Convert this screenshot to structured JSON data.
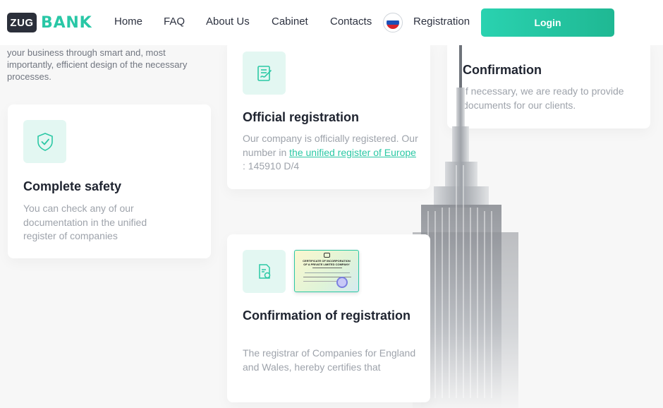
{
  "header": {
    "logo_zug": "ZUG",
    "logo_bank": "BANK",
    "nav": [
      {
        "label": "Home"
      },
      {
        "label": "FAQ"
      },
      {
        "label": "About Us"
      },
      {
        "label": "Cabinet"
      },
      {
        "label": "Contacts"
      }
    ],
    "registration_label": "Registration",
    "login_label": "Login"
  },
  "intro": {
    "text": "your business through smart and, most importantly, efficient design of the necessary processes."
  },
  "cards": {
    "safety": {
      "title": "Complete safety",
      "text": "You can check any of our documentation in the unified register of companies"
    },
    "official": {
      "title": "Official registration",
      "text_before": "Our company is officially registered. Our number in ",
      "link": "the unified register of Europe",
      "text_after": " : 145910 D/4"
    },
    "confirmation": {
      "title": "Confirmation",
      "text": "If necessary, we are ready to provide documents for our clients."
    },
    "confirmation_registration": {
      "title": "Confirmation of registration",
      "text": "The registrar of Companies for England and Wales, hereby certifies that"
    }
  },
  "certificate": {
    "line1": "CERTIFICATE OF INCORPORATION",
    "line2": "OF A PRIVATE LIMITED COMPANY"
  },
  "colors": {
    "accent": "#29c7a6",
    "icon_bg": "#e3f7f2",
    "dark": "#2b2f3a",
    "muted": "#9ea3ab"
  },
  "icons": {
    "safety": "shield-check-icon",
    "official": "document-signature-icon",
    "confirmation": "document-seal-icon",
    "language": "russia-flag-icon"
  }
}
